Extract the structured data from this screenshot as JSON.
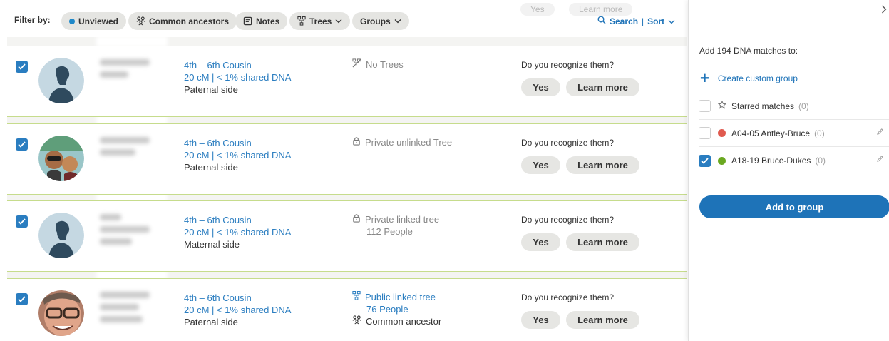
{
  "filter_bar": {
    "label": "Filter by:",
    "chips": [
      {
        "label": "Unviewed",
        "icon": "dot-icon",
        "color": "#1e88c9"
      },
      {
        "label": "Common ancestors",
        "icon": "family-icon"
      },
      {
        "label": "Notes",
        "icon": "note-icon"
      },
      {
        "label": "Trees",
        "icon": "tree-icon",
        "dropdown": true
      },
      {
        "label": "Groups",
        "dropdown": true
      }
    ],
    "search_label": "Search",
    "separator": "|",
    "sort_label": "Sort"
  },
  "partial_top": {
    "yes_label": "Yes",
    "learn_label": "Learn more"
  },
  "matches": [
    {
      "checked": true,
      "avatar": "silhouette",
      "relationship": "4th – 6th Cousin",
      "shared": "20 cM | < 1% shared DNA",
      "side": "Paternal side",
      "tree_icon": "no-tree-icon",
      "tree_status": "No Trees",
      "tree_sub": "",
      "common_ancestor": "",
      "question": "Do you recognize them?",
      "yes_label": "Yes",
      "learn_label": "Learn more"
    },
    {
      "checked": true,
      "avatar": "photo",
      "relationship": "4th – 6th Cousin",
      "shared": "20 cM | < 1% shared DNA",
      "side": "Paternal side",
      "tree_icon": "lock-icon",
      "tree_status": "Private unlinked Tree",
      "tree_sub": "",
      "common_ancestor": "",
      "question": "Do you recognize them?",
      "yes_label": "Yes",
      "learn_label": "Learn more"
    },
    {
      "checked": true,
      "avatar": "silhouette",
      "relationship": "4th – 6th Cousin",
      "shared": "20 cM | < 1% shared DNA",
      "side": "Maternal side",
      "tree_icon": "lock-icon",
      "tree_status": "Private linked tree",
      "tree_sub": "112 People",
      "common_ancestor": "",
      "question": "Do you recognize them?",
      "yes_label": "Yes",
      "learn_label": "Learn more"
    },
    {
      "checked": true,
      "avatar": "photo",
      "relationship": "4th – 6th Cousin",
      "shared": "20 cM | < 1% shared DNA",
      "side": "Paternal side",
      "tree_icon": "tree-icon",
      "tree_status": "Public linked tree",
      "tree_sub": "76 People",
      "common_ancestor": "Common ancestor",
      "question": "Do you recognize them?",
      "yes_label": "Yes",
      "learn_label": "Learn more"
    }
  ],
  "panel": {
    "close_icon": "chevron-right-icon",
    "title": "Add 194 DNA matches to:",
    "create_label": "Create custom group",
    "groups": [
      {
        "name": "Starred matches",
        "count": "(0)",
        "icon": "star-icon",
        "checked": false
      },
      {
        "name": "A04-05 Antley-Bruce",
        "count": "(0)",
        "color": "#e05a4f",
        "checked": false,
        "editable": true
      },
      {
        "name": "A18-19 Bruce-Dukes",
        "count": "(0)",
        "color": "#6aa820",
        "checked": true,
        "editable": true
      }
    ],
    "add_button": "Add to group"
  },
  "colors": {
    "accent": "#1e73b8",
    "link": "#2a7dc0",
    "card_border": "#c6dc8c",
    "chip_bg": "#e5e5e2"
  }
}
